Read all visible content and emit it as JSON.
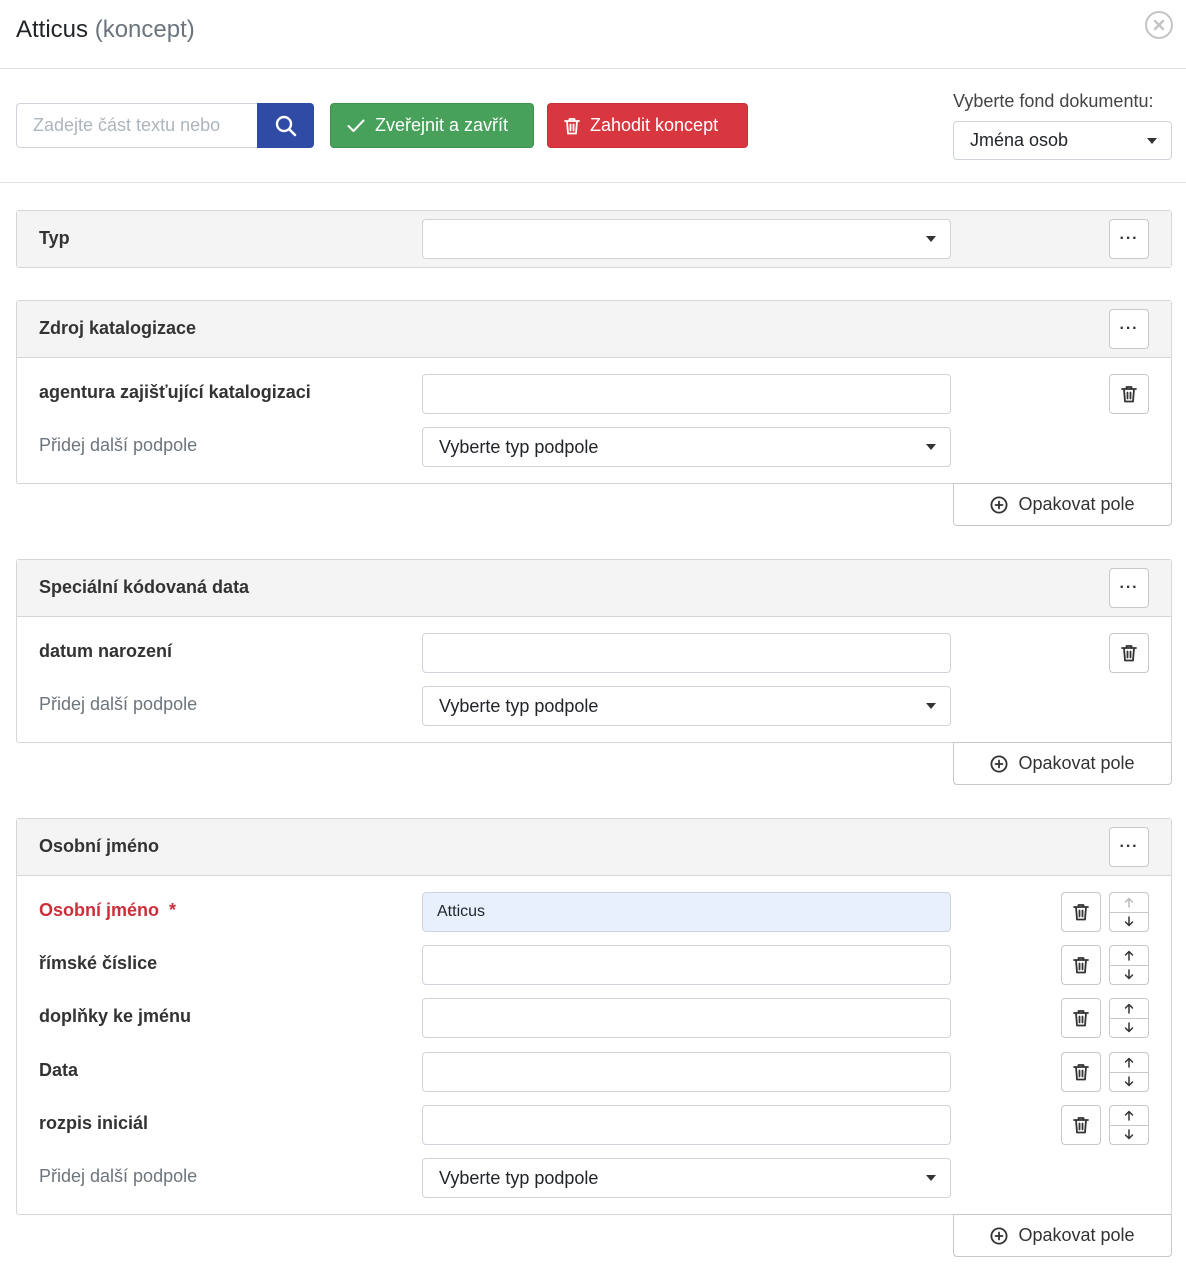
{
  "header": {
    "title": "Atticus",
    "title_suffix": "(koncept)"
  },
  "toolbar": {
    "search_placeholder": "Zadejte část textu nebo",
    "publish_label": "Zveřejnit a zavřít",
    "discard_label": "Zahodit koncept",
    "fond_label": "Vyberte fond dokumentu:",
    "fond_value": "Jména osob"
  },
  "common": {
    "add_subfield_label": "Přidej další podpole",
    "add_subfield_placeholder": "Vyberte typ podpole",
    "repeat_label": "Opakovat pole",
    "dots": "···"
  },
  "sections": {
    "typ": {
      "title": "Typ",
      "value": ""
    },
    "zdroj": {
      "title": "Zdroj katalogizace",
      "field_label": "agentura zajišťující katalogizaci",
      "field_value": ""
    },
    "special": {
      "title": "Speciální kódovaná data",
      "field_label": "datum narození",
      "field_value": ""
    },
    "osobni": {
      "title": "Osobní jméno",
      "required_mark": "*",
      "fields": [
        {
          "label": "Osobní jméno",
          "value": "Atticus",
          "required": true
        },
        {
          "label": "římské číslice",
          "value": ""
        },
        {
          "label": "doplňky ke jménu",
          "value": ""
        },
        {
          "label": "Data",
          "value": ""
        },
        {
          "label": "rozpis iniciál",
          "value": ""
        }
      ]
    }
  },
  "colors": {
    "primary": "#2f4ba6",
    "success": "#48a15a",
    "danger": "#d9373f",
    "required": "#cc2e3a"
  }
}
